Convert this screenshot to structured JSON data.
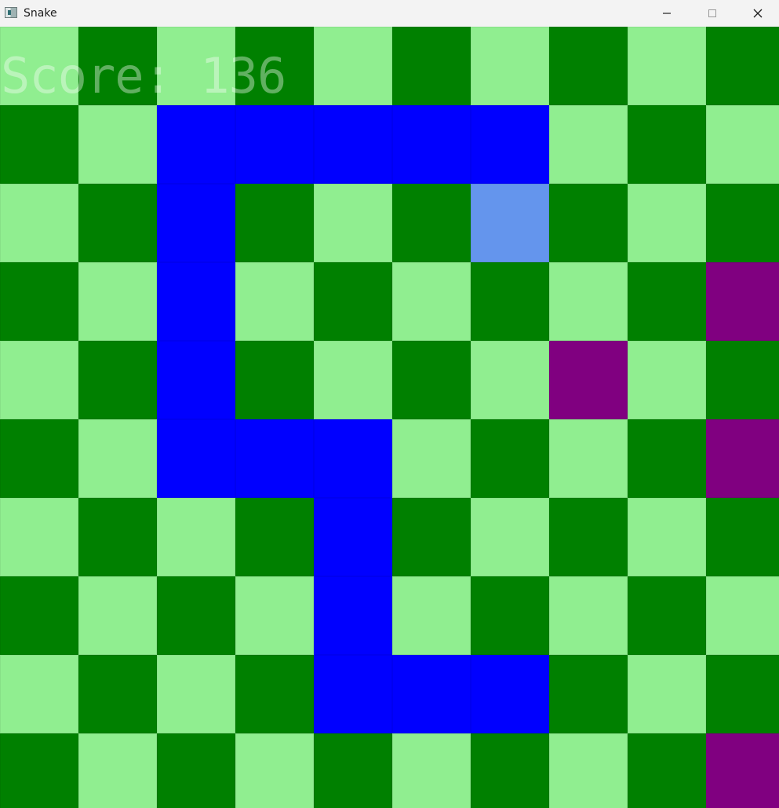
{
  "window": {
    "title": "Snake",
    "icon": "snake-app-icon"
  },
  "window_controls": {
    "minimize_icon": "minimize-icon",
    "maximize_icon": "maximize-icon",
    "close_icon": "close-icon"
  },
  "game": {
    "score_text": "Score: 136",
    "score": 136,
    "grid": {
      "columns": 10,
      "rows": 10
    },
    "colors": {
      "dark_tile": "#008000",
      "light_tile": "#90ee90",
      "snake_body": "#0000ff",
      "snake_head": "#6495ed",
      "obstacle": "#800080"
    },
    "snake_head": {
      "row": 2,
      "col": 6
    },
    "snake_body": [
      {
        "row": 1,
        "col": 6
      },
      {
        "row": 1,
        "col": 5
      },
      {
        "row": 1,
        "col": 4
      },
      {
        "row": 1,
        "col": 3
      },
      {
        "row": 1,
        "col": 2
      },
      {
        "row": 2,
        "col": 2
      },
      {
        "row": 3,
        "col": 2
      },
      {
        "row": 4,
        "col": 2
      },
      {
        "row": 5,
        "col": 2
      },
      {
        "row": 5,
        "col": 3
      },
      {
        "row": 5,
        "col": 4
      },
      {
        "row": 6,
        "col": 4
      },
      {
        "row": 7,
        "col": 4
      },
      {
        "row": 8,
        "col": 4
      },
      {
        "row": 8,
        "col": 5
      },
      {
        "row": 8,
        "col": 6
      }
    ],
    "obstacles": [
      {
        "row": 3,
        "col": 9
      },
      {
        "row": 4,
        "col": 7
      },
      {
        "row": 5,
        "col": 9
      },
      {
        "row": 9,
        "col": 9
      }
    ]
  }
}
